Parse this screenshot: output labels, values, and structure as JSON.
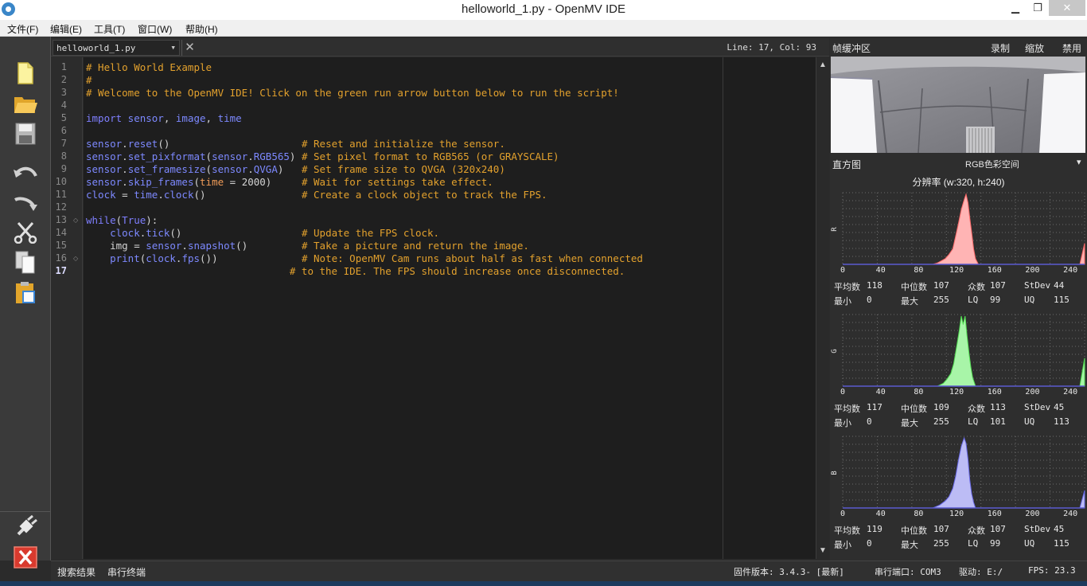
{
  "window": {
    "title": "helloworld_1.py - OpenMV IDE",
    "minimize": "▁",
    "maximize": "❐",
    "close": "✕"
  },
  "menubar": {
    "items": [
      "文件(F)",
      "编辑(E)",
      "工具(T)",
      "窗口(W)",
      "帮助(H)"
    ]
  },
  "toolbar": {
    "icons": [
      "new-file-icon",
      "open-folder-icon",
      "save-icon",
      "undo-icon",
      "redo-icon",
      "cut-icon",
      "copy-icon",
      "paste-icon"
    ],
    "bottom_icons": [
      "connect-icon",
      "stop-icon"
    ]
  },
  "editor": {
    "tab_label": "helloworld_1.py",
    "tab_dropdown": "▾",
    "tab_close": "✕",
    "cursor_position": "Line: 17, Col: 93",
    "current_line": 17,
    "fold_lines": [
      13,
      16
    ],
    "lines": [
      [
        {
          "t": "# Hello World Example",
          "c": "com"
        }
      ],
      [
        {
          "t": "#",
          "c": "com"
        }
      ],
      [
        {
          "t": "# Welcome to the OpenMV IDE! Click on the green run arrow button below to run the script!",
          "c": "com"
        }
      ],
      [],
      [
        {
          "t": "import",
          "c": "kw"
        },
        {
          "t": " sensor",
          "c": "id"
        },
        {
          "t": ", ",
          "c": "pl"
        },
        {
          "t": "image",
          "c": "id"
        },
        {
          "t": ", ",
          "c": "pl"
        },
        {
          "t": "time",
          "c": "id"
        }
      ],
      [],
      [
        {
          "t": "sensor",
          "c": "id"
        },
        {
          "t": ".",
          "c": "pl"
        },
        {
          "t": "reset",
          "c": "id"
        },
        {
          "t": "()",
          "c": "pl"
        },
        {
          "t": "                      ",
          "c": "pl"
        },
        {
          "t": "# Reset and initialize the sensor.",
          "c": "com"
        }
      ],
      [
        {
          "t": "sensor",
          "c": "id"
        },
        {
          "t": ".",
          "c": "pl"
        },
        {
          "t": "set_pixformat",
          "c": "id"
        },
        {
          "t": "(",
          "c": "pl"
        },
        {
          "t": "sensor",
          "c": "id"
        },
        {
          "t": ".",
          "c": "pl"
        },
        {
          "t": "RGB565",
          "c": "id"
        },
        {
          "t": ")",
          "c": "pl"
        },
        {
          "t": " ",
          "c": "pl"
        },
        {
          "t": "# Set pixel format to RGB565 (or GRAYSCALE)",
          "c": "com"
        }
      ],
      [
        {
          "t": "sensor",
          "c": "id"
        },
        {
          "t": ".",
          "c": "pl"
        },
        {
          "t": "set_framesize",
          "c": "id"
        },
        {
          "t": "(",
          "c": "pl"
        },
        {
          "t": "sensor",
          "c": "id"
        },
        {
          "t": ".",
          "c": "pl"
        },
        {
          "t": "QVGA",
          "c": "id"
        },
        {
          "t": ")",
          "c": "pl"
        },
        {
          "t": "   ",
          "c": "pl"
        },
        {
          "t": "# Set frame size to QVGA (320x240)",
          "c": "com"
        }
      ],
      [
        {
          "t": "sensor",
          "c": "id"
        },
        {
          "t": ".",
          "c": "pl"
        },
        {
          "t": "skip_frames",
          "c": "id"
        },
        {
          "t": "(",
          "c": "pl"
        },
        {
          "t": "time",
          "c": "kwarg"
        },
        {
          "t": " = 2000)",
          "c": "pl"
        },
        {
          "t": "     ",
          "c": "pl"
        },
        {
          "t": "# Wait for settings take effect.",
          "c": "com"
        }
      ],
      [
        {
          "t": "clock",
          "c": "id"
        },
        {
          "t": " = ",
          "c": "pl"
        },
        {
          "t": "time",
          "c": "id"
        },
        {
          "t": ".",
          "c": "pl"
        },
        {
          "t": "clock",
          "c": "id"
        },
        {
          "t": "()",
          "c": "pl"
        },
        {
          "t": "                ",
          "c": "pl"
        },
        {
          "t": "# Create a clock object to track the FPS.",
          "c": "com"
        }
      ],
      [],
      [
        {
          "t": "while",
          "c": "kw"
        },
        {
          "t": "(",
          "c": "pl"
        },
        {
          "t": "True",
          "c": "kw"
        },
        {
          "t": "):",
          "c": "pl"
        }
      ],
      [
        {
          "t": "    ",
          "c": "pl"
        },
        {
          "t": "clock",
          "c": "id"
        },
        {
          "t": ".",
          "c": "pl"
        },
        {
          "t": "tick",
          "c": "id"
        },
        {
          "t": "()",
          "c": "pl"
        },
        {
          "t": "                    ",
          "c": "pl"
        },
        {
          "t": "# Update the FPS clock.",
          "c": "com"
        }
      ],
      [
        {
          "t": "    img = ",
          "c": "pl"
        },
        {
          "t": "sensor",
          "c": "id"
        },
        {
          "t": ".",
          "c": "pl"
        },
        {
          "t": "snapshot",
          "c": "id"
        },
        {
          "t": "()",
          "c": "pl"
        },
        {
          "t": "         ",
          "c": "pl"
        },
        {
          "t": "# Take a picture and return the image.",
          "c": "com"
        }
      ],
      [
        {
          "t": "    ",
          "c": "pl"
        },
        {
          "t": "print",
          "c": "id"
        },
        {
          "t": "(",
          "c": "pl"
        },
        {
          "t": "clock",
          "c": "id"
        },
        {
          "t": ".",
          "c": "pl"
        },
        {
          "t": "fps",
          "c": "id"
        },
        {
          "t": "())",
          "c": "pl"
        },
        {
          "t": "              ",
          "c": "pl"
        },
        {
          "t": "# Note: OpenMV Cam runs about half as fast when connected",
          "c": "com"
        }
      ],
      [
        {
          "t": "                                  ",
          "c": "pl"
        },
        {
          "t": "# to the IDE. The FPS should increase once disconnected.",
          "c": "com"
        }
      ]
    ]
  },
  "frame_buffer": {
    "title": "帧缓冲区",
    "record": "录制",
    "zoom": "缩放",
    "disable": "禁用"
  },
  "histogram": {
    "title": "直方图",
    "color_space": "RGB色彩空间",
    "dropdown": "▾",
    "resolution": "分辨率 (w:320, h:240)",
    "x_ticks": [
      "0",
      "40",
      "80",
      "120",
      "160",
      "200",
      "240"
    ],
    "stat_labels": {
      "mean": "平均数",
      "median": "中位数",
      "mode": "众数",
      "stdev": "StDev",
      "min": "最小",
      "max": "最大",
      "lq": "LQ",
      "uq": "UQ"
    },
    "channels": [
      {
        "label": "R",
        "color": "#ffb4b4",
        "stroke": "#ff6a6a",
        "mean": "118",
        "median": "107",
        "mode": "107",
        "stdev": "44",
        "min": "0",
        "max": "255",
        "lq": "99",
        "uq": "115"
      },
      {
        "label": "G",
        "color": "#a8f5a8",
        "stroke": "#54e054",
        "mean": "117",
        "median": "109",
        "mode": "113",
        "stdev": "45",
        "min": "0",
        "max": "255",
        "lq": "101",
        "uq": "113"
      },
      {
        "label": "B",
        "color": "#bcbcf5",
        "stroke": "#6a6ae8",
        "mean": "119",
        "median": "107",
        "mode": "107",
        "stdev": "45",
        "min": "0",
        "max": "255",
        "lq": "99",
        "uq": "115"
      }
    ]
  },
  "statusbar": {
    "search_results": "搜索结果",
    "serial_terminal": "串行终端",
    "firmware": "固件版本: 3.4.3- [最新]",
    "serial_port": "串行端口: COM3",
    "drive": "驱动: E:/",
    "fps": "FPS: 23.3"
  }
}
